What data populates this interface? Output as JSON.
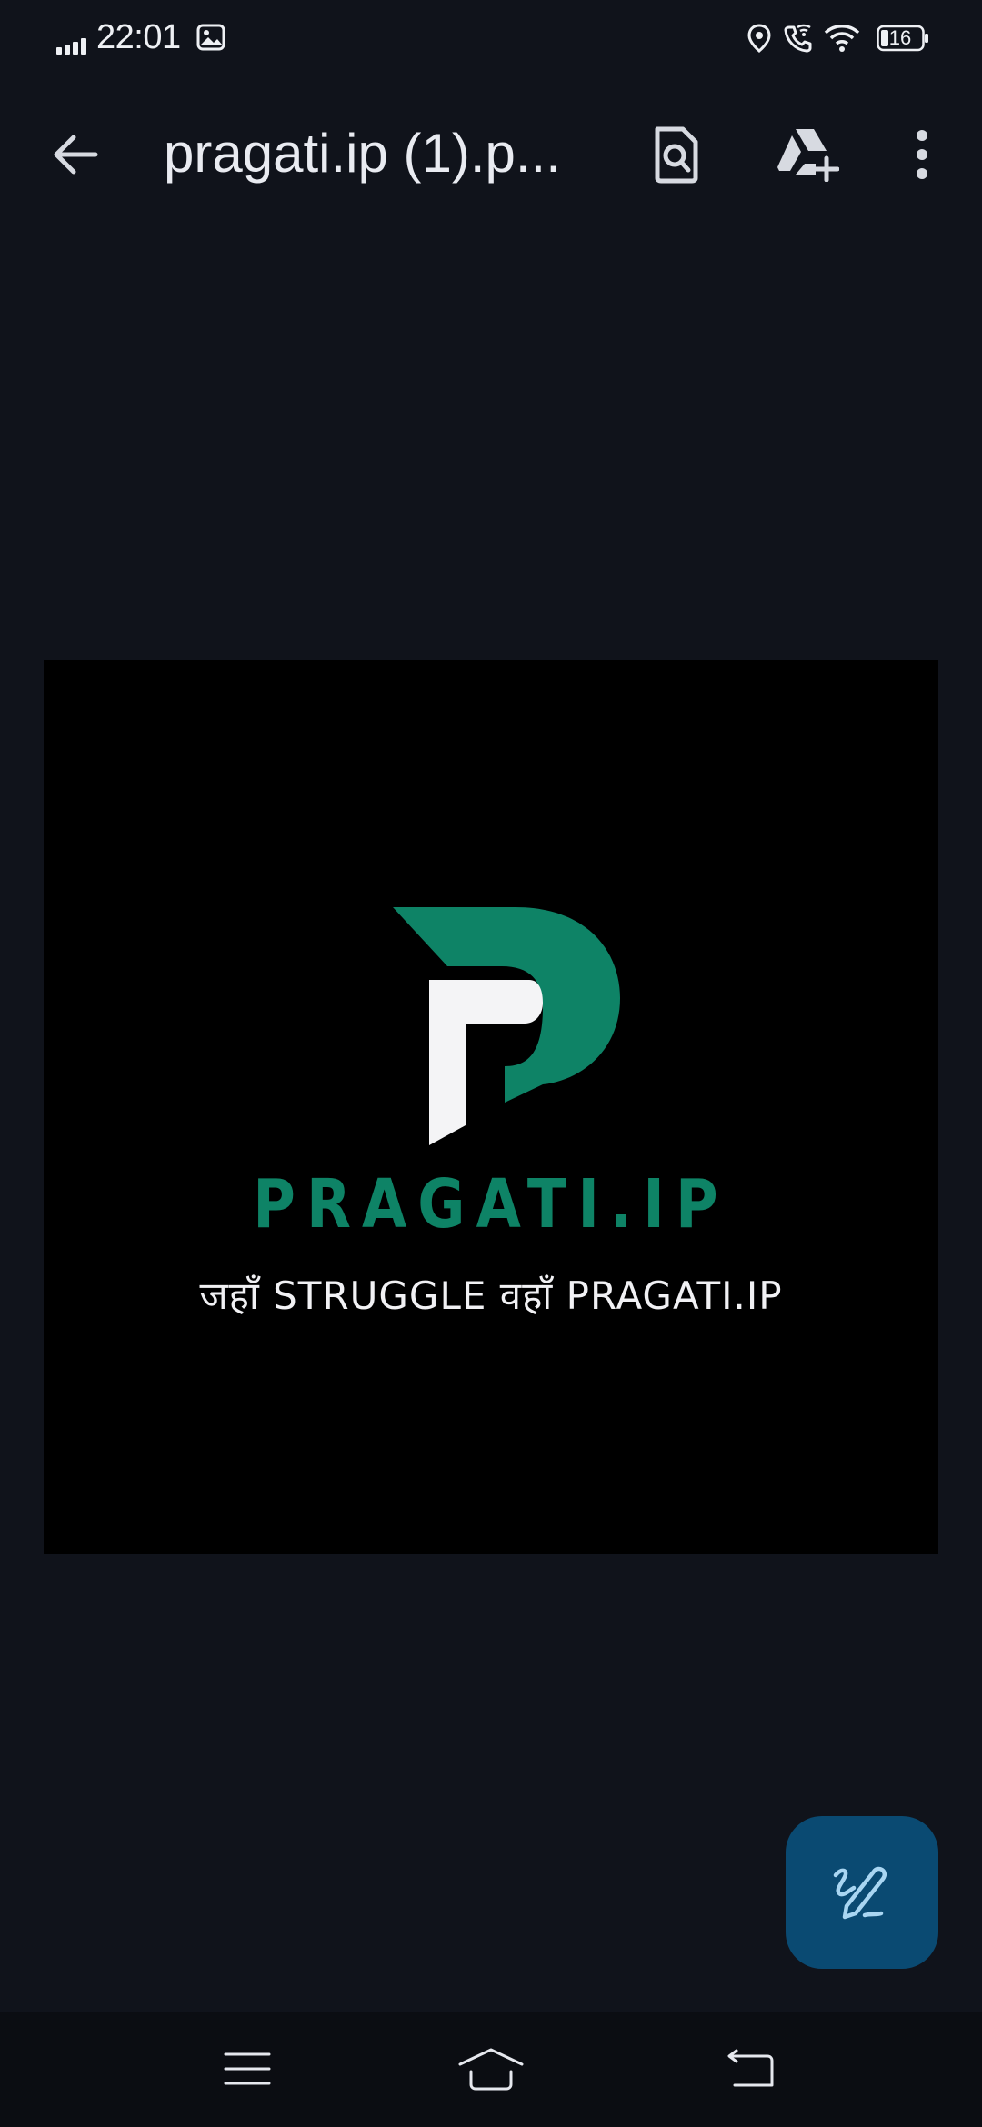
{
  "status_bar": {
    "time": "22:01",
    "battery_level": "16",
    "icons": [
      "signal-icon",
      "gallery-icon",
      "location-icon",
      "wifi-call-icon",
      "wifi-icon",
      "battery-icon"
    ]
  },
  "app_bar": {
    "title": "pragati.ip (1).p...",
    "icons": {
      "back": "arrow-back-icon",
      "find": "find-in-page-icon",
      "drive": "add-to-drive-icon",
      "more": "more-vert-icon"
    }
  },
  "document": {
    "brand_name": "PRAGATI.IP",
    "tagline": "जहाँ STRUGGLE वहाँ PRAGATI.IP",
    "logo": "pragati-p-logo"
  },
  "fab": {
    "icon": "annotate-pen-icon"
  },
  "nav_bar": {
    "icons": [
      "menu-icon",
      "home-icon",
      "back-icon"
    ]
  },
  "colors": {
    "background": "#10131b",
    "page": "#000000",
    "brand_green": "#0e8366",
    "fab": "#0a4a72",
    "fab_icon": "#a9d6f2"
  }
}
